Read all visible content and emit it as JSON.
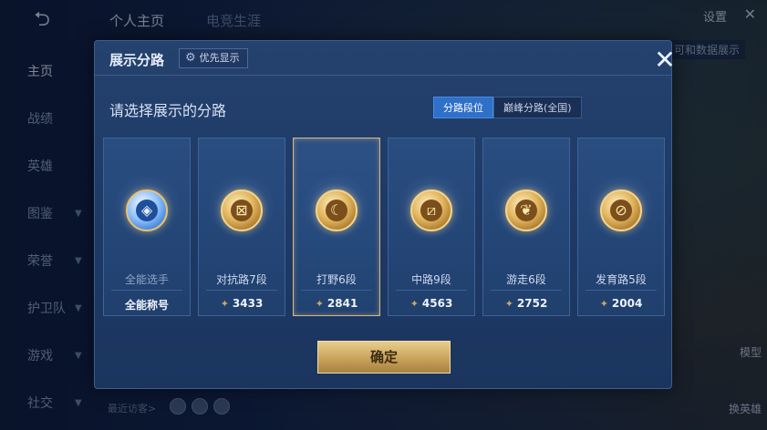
{
  "background": {
    "back_icon": "back-arrow-icon",
    "top_tabs": [
      {
        "label": "个人主页",
        "active": true
      },
      {
        "label": "电竞生涯",
        "active": false
      }
    ],
    "settings_label": "设置",
    "data_show_label": "可和数据展示",
    "sidenav": [
      {
        "label": "主页",
        "active": true,
        "chevron": false
      },
      {
        "label": "战绩",
        "active": false,
        "chevron": false
      },
      {
        "label": "英雄",
        "active": false,
        "chevron": false
      },
      {
        "label": "图鉴",
        "active": false,
        "chevron": true
      },
      {
        "label": "荣誉",
        "active": false,
        "chevron": true
      },
      {
        "label": "护卫队",
        "active": false,
        "chevron": true
      },
      {
        "label": "游戏",
        "active": false,
        "chevron": true
      },
      {
        "label": "社交",
        "active": false,
        "chevron": true
      }
    ],
    "recent_visitors_label": "最近访客>",
    "right_actions": [
      "模型",
      "换英雄"
    ]
  },
  "modal": {
    "title": "展示分路",
    "priority_label": "优先显示",
    "close_icon": "close-x-icon",
    "prompt": "请选择展示的分路",
    "toggle": [
      {
        "label": "分路段位",
        "active": true
      },
      {
        "label": "巅峰分路(全国)",
        "active": false
      }
    ],
    "cards": [
      {
        "label": "全能选手",
        "value": "全能称号",
        "icon": "all-round-badge-icon",
        "glyph": "◈",
        "selected": false,
        "show_points": false
      },
      {
        "label": "对抗路7段",
        "value": "3433",
        "icon": "clash-lane-badge-icon",
        "glyph": "⊠",
        "selected": false,
        "show_points": true
      },
      {
        "label": "打野6段",
        "value": "2841",
        "icon": "jungle-badge-icon",
        "glyph": "☾",
        "selected": true,
        "show_points": true
      },
      {
        "label": "中路9段",
        "value": "4563",
        "icon": "mid-lane-badge-icon",
        "glyph": "⧄",
        "selected": false,
        "show_points": true
      },
      {
        "label": "游走6段",
        "value": "2752",
        "icon": "roam-badge-icon",
        "glyph": "❦",
        "selected": false,
        "show_points": true
      },
      {
        "label": "发育路5段",
        "value": "2004",
        "icon": "farm-lane-badge-icon",
        "glyph": "⊘",
        "selected": false,
        "show_points": true
      }
    ],
    "confirm_label": "确定"
  },
  "colors": {
    "modal_bg": "#1e3a66",
    "toggle_active": "#2f70c8",
    "gold": "#d9b887",
    "confirm_gold": "#c9a25b"
  }
}
